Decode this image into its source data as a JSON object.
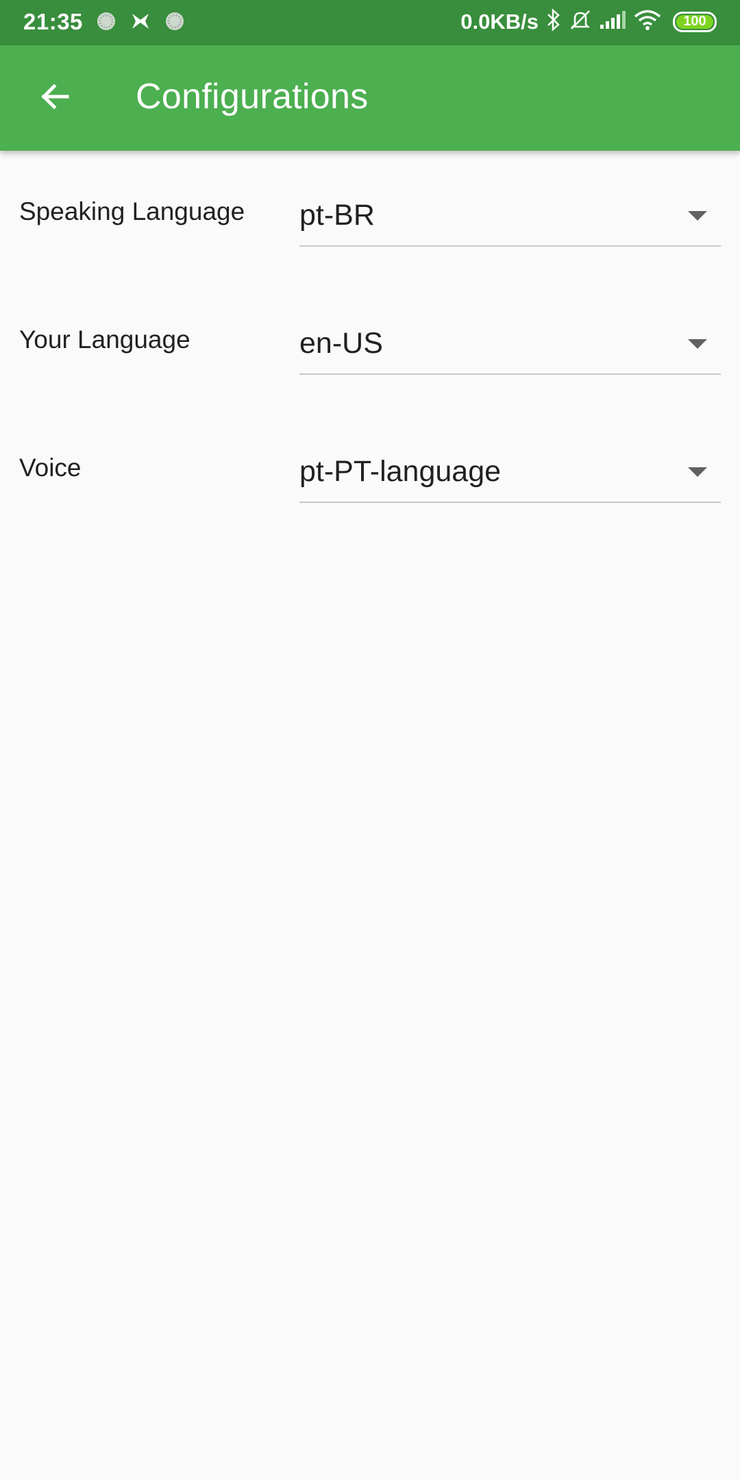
{
  "status_bar": {
    "time": "21:35",
    "network_speed": "0.0KB/s",
    "battery_level": "100",
    "icons": [
      "app-notification-icon",
      "butterfly-icon",
      "app-notification-icon",
      "bluetooth-icon",
      "silent-mode-icon",
      "signal-icon",
      "wifi-icon",
      "battery-icon"
    ]
  },
  "app_bar": {
    "title": "Configurations",
    "back_icon": "arrow-back-icon"
  },
  "settings": [
    {
      "label": "Speaking Language",
      "value": "pt-BR"
    },
    {
      "label": "Your Language",
      "value": "en-US"
    },
    {
      "label": "Voice",
      "value": "pt-PT-language"
    }
  ],
  "colors": {
    "status_bar": "#388e3c",
    "app_bar": "#4caf50",
    "background": "#fafafa"
  }
}
